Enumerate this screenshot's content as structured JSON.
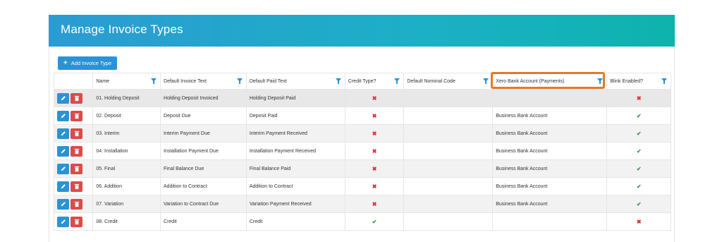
{
  "page": {
    "title": "Manage Invoice Types"
  },
  "toolbar": {
    "add_label": "Add Invoice Type",
    "add_icon": "plus-icon"
  },
  "columns": [
    "Name",
    "Default Invoice Text",
    "Default Paid Text",
    "Credit Type?",
    "Default Nominal Code",
    "Xero Bank Account (Payments)",
    "Blink Enabled?"
  ],
  "rows": [
    {
      "name": "01. Holding Deposit",
      "invoice_text": "Holding Deposit Invoiced",
      "paid_text": "Holding Deposit Paid",
      "credit": "✖",
      "nominal": "",
      "xero": "",
      "blink": "✖"
    },
    {
      "name": "02. Deposit",
      "invoice_text": "Deposit Due",
      "paid_text": "Deposit Paid",
      "credit": "✖",
      "nominal": "",
      "xero": "Business Bank Account",
      "blink": "✔"
    },
    {
      "name": "03. Interim",
      "invoice_text": "Interim Payment Due",
      "paid_text": "Interim Payment Received",
      "credit": "✖",
      "nominal": "",
      "xero": "Business Bank Account",
      "blink": "✔"
    },
    {
      "name": "04. Installation",
      "invoice_text": "Installation Payment Due",
      "paid_text": "Installation Payment Received",
      "credit": "✖",
      "nominal": "",
      "xero": "Business Bank Account",
      "blink": "✔"
    },
    {
      "name": "05. Final",
      "invoice_text": "Final Balance Due",
      "paid_text": "Final Balance Paid",
      "credit": "✖",
      "nominal": "",
      "xero": "Business Bank Account",
      "blink": "✔"
    },
    {
      "name": "06. Addition",
      "invoice_text": "Addition to Contract",
      "paid_text": "Addition to Contract",
      "credit": "✖",
      "nominal": "",
      "xero": "Business Bank Account",
      "blink": "✔"
    },
    {
      "name": "07. Variation",
      "invoice_text": "Variation to Contract Due",
      "paid_text": "Variation Payment Received",
      "credit": "✖",
      "nominal": "",
      "xero": "Business Bank Account",
      "blink": "✔"
    },
    {
      "name": "08. Credit",
      "invoice_text": "Credit",
      "paid_text": "Credit",
      "credit": "✔",
      "nominal": "",
      "xero": "",
      "blink": "✖"
    }
  ],
  "colors": {
    "header_start": "#2b9bd3",
    "header_end": "#0db3ad",
    "accent": "#2a93d5",
    "delete": "#dd4a4a",
    "highlight": "#e07b2a",
    "yes": "#2f9e3f",
    "no": "#e0352b"
  }
}
